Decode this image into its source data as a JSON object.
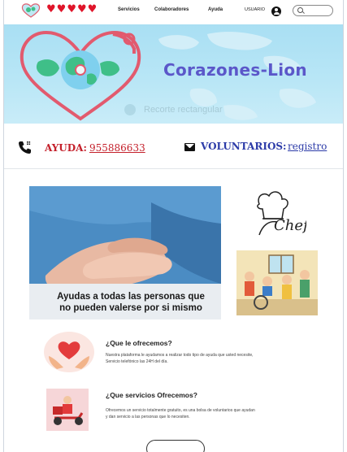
{
  "nav": {
    "links": [
      "Servicios",
      "Colaboradores",
      "Ayuda"
    ],
    "user_label": "USUARIO",
    "search_placeholder": ""
  },
  "hero": {
    "title": "Corazones-Lion",
    "overlay_text": "Recorte rectangular"
  },
  "contact": {
    "help_label": "AYUDA:",
    "help_number": "955886633",
    "volunteers_label": "VOLUNTARIOS:",
    "volunteers_link": "registro"
  },
  "main": {
    "photo_caption_line1": "Ayudas a todas las personas que",
    "photo_caption_line2": "no pueden valerse por si mismo"
  },
  "sections": [
    {
      "title": "¿Que le ofrecemos?",
      "text_line1": "Nuestra plataforma le ayudamos a realizar todo tipo de ayuda que usted necesite,",
      "text_line2": "Servicio telefónico las 24H del día."
    },
    {
      "title": "¿Que servicios Ofrecemos?",
      "text_line1": "Ofrecemos un servicio totalmente gratuito, es una bolsa de voluntarios que ayudan",
      "text_line2": "y dan servicio a las personas que lo necesiten."
    }
  ],
  "colors": {
    "accent_red": "#c4202b",
    "accent_blue": "#2c3ba8",
    "title_purple": "#5b57c9",
    "hero_bg": "#b8e6f6"
  }
}
